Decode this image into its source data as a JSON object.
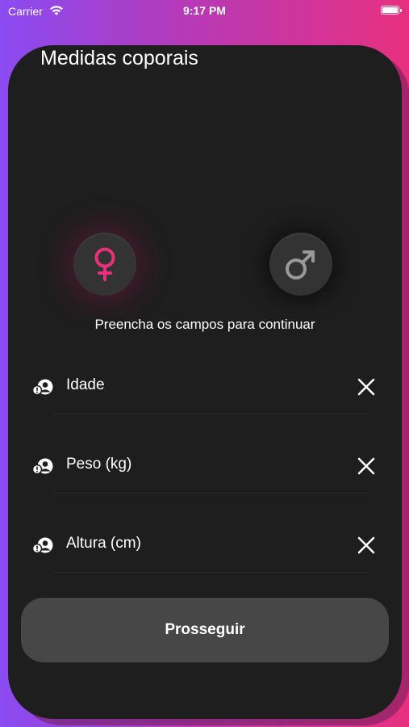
{
  "status_bar": {
    "carrier": "Carrier",
    "time": "9:17 PM"
  },
  "page": {
    "title": "Medidas coporais",
    "hint": "Preencha os campos para continuar"
  },
  "gender": {
    "female_icon": "female-symbol-icon",
    "male_icon": "male-symbol-icon",
    "female_color": "#e8317a",
    "male_color": "#9a9a9a"
  },
  "fields": [
    {
      "label": "Idade",
      "icon": "person-warning-icon",
      "clear_icon": "close-icon"
    },
    {
      "label": "Peso (kg)",
      "icon": "person-warning-icon",
      "clear_icon": "close-icon"
    },
    {
      "label": "Altura (cm)",
      "icon": "person-warning-icon",
      "clear_icon": "close-icon"
    }
  ],
  "actions": {
    "proceed_label": "Prosseguir"
  },
  "colors": {
    "card_bg": "#1e1e1e",
    "button_bg": "#474747",
    "gradient_start": "#8a4bf2",
    "gradient_end": "#e8307f"
  }
}
